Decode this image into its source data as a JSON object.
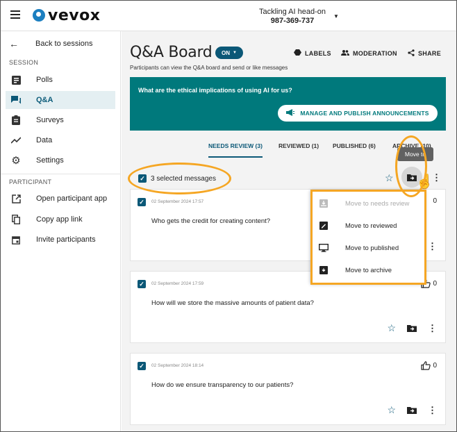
{
  "header": {
    "logo_text": "vevox",
    "session_title": "Tackling AI head-on",
    "session_code": "987-369-737"
  },
  "sidebar": {
    "back_label": "Back to sessions",
    "session_label": "SESSION",
    "participant_label": "PARTICIPANT",
    "items": [
      {
        "label": "Polls"
      },
      {
        "label": "Q&A"
      },
      {
        "label": "Surveys"
      },
      {
        "label": "Data"
      },
      {
        "label": "Settings"
      }
    ],
    "participant_items": [
      {
        "label": "Open participant app"
      },
      {
        "label": "Copy app link"
      },
      {
        "label": "Invite participants"
      }
    ]
  },
  "main": {
    "title": "Q&A Board",
    "on_label": "ON",
    "labels_btn": "LABELS",
    "moderation_btn": "MODERATION",
    "share_btn": "SHARE",
    "subtitle": "Participants can view the Q&A board and send or like messages",
    "banner_question": "What are the ethical implications of using AI for us?",
    "banner_button": "MANAGE AND PUBLISH ANNOUNCEMENTS",
    "tabs": [
      {
        "label": "NEEDS REVIEW (3)"
      },
      {
        "label": "REVIEWED (1)"
      },
      {
        "label": "PUBLISHED (6)"
      },
      {
        "label": "ARCHIVE (10)"
      }
    ],
    "selected_text": "3 selected messages",
    "tooltip": "Move to",
    "menu": [
      {
        "label": "Move to needs review"
      },
      {
        "label": "Move to reviewed"
      },
      {
        "label": "Move to published"
      },
      {
        "label": "Move to archive"
      }
    ],
    "messages": [
      {
        "date": "02 September 2024 17:57",
        "text": "Who gets the credit for creating content?",
        "likes": "0"
      },
      {
        "date": "02 September 2024 17:59",
        "text": "How will we store the massive amounts of patient data?",
        "likes": "0"
      },
      {
        "date": "02 September 2024 18:14",
        "text": "How do we ensure transparency to our patients?",
        "likes": "0"
      }
    ]
  },
  "colors": {
    "brand": "#0b5877",
    "banner": "#00797c",
    "highlight": "#f5a623",
    "logo": "#1c7fc0"
  }
}
